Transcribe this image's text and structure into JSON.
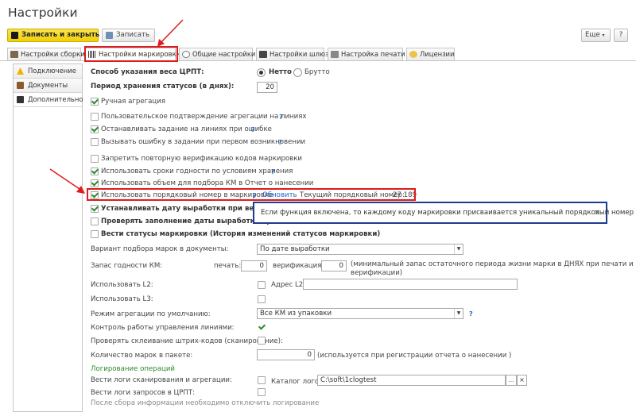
{
  "window": {
    "title": "Настройки"
  },
  "toolbar": {
    "save_close": "Записать и закрыть",
    "write": "Записать",
    "more": "Еще",
    "help": "?"
  },
  "tabs": [
    {
      "label": "Настройки сборки"
    },
    {
      "label": "Настройки маркировки"
    },
    {
      "label": "Общие настройки"
    },
    {
      "label": "Настройки шлюз"
    },
    {
      "label": "Настройка печати"
    },
    {
      "label": "Лицензии"
    }
  ],
  "left_tabs": [
    {
      "label": "Подключение"
    },
    {
      "label": "Документы"
    },
    {
      "label": "Дополнительно"
    }
  ],
  "weight": {
    "label": "Способ указания веса ЦРПТ:",
    "net": "Нетто",
    "gross": "Брутто"
  },
  "storage": {
    "label": "Период хранения статусов (в днях):",
    "value": "20"
  },
  "checks": {
    "manual": "Ручная агрегация",
    "confirm": "Пользовательское подтверждение агрегации на линиях",
    "stop": "Останавливать задание на линиях при ошибке",
    "firsterr": "Вызывать ошибку в задании при первом возникновении",
    "forbid": "Запретить повторную верификацию кодов маркировки",
    "expiry": "Использовать сроки годности по условиям хранения",
    "volume": "Использовать объем для подбора КМ в Отчет о нанесении",
    "seq": "Использовать порядковый номер в маркировке",
    "setdate": "Устанавливать дату выработки при верифик",
    "checkdate": "Проверять заполнение даты выработки при",
    "history": "Вести статусы маркировки (История изменений статусов маркировки)"
  },
  "seq_extra": {
    "help": "?",
    "refresh": "Обновить",
    "current_label": "Текущий порядковый номер:",
    "current_value": "27 189"
  },
  "tooltip": {
    "text": "Если функция включена, то каждому коду маркировки присваивается уникальный порядковый номер",
    "close": "×"
  },
  "form": {
    "variant_label": "Вариант подбора марок в документы:",
    "variant_value": "По дате выработки",
    "reserve_label": "Запас годности КМ:",
    "print_label": "печать:",
    "print_value": "0",
    "verif_label": "верификация:",
    "verif_value": "0",
    "reserve_note_1": "(минимальный запас остаточного периода жизни марки в ДНЯХ при печати и",
    "reserve_note_2": "верификации)",
    "l2_label": "Использовать L2:",
    "l2_addr_label": "Адрес L2:",
    "l3_label": "Использовать L3:",
    "mode_label": "Режим агрегации по умолчанию:",
    "mode_value": "Все КМ из упаковки",
    "lines_label": "Контроль работы управления линиями:",
    "glue_label": "Проверять склеивание штрих-кодов (сканирование):",
    "qty_label": "Количество марок в пакете:",
    "qty_value": "0",
    "qty_note": "(используется при регистрации  отчета о нанесении )",
    "log_section": "Логирование операций",
    "log_scan_label": "Вести логи сканирования и агрегации:",
    "log_dir_label": "Каталог логов:",
    "log_dir_value": "C:\\soft\\1clogtest",
    "log_crpt_label": "Вести логи запросов в ЦРПТ:",
    "footer_note": "После сбора информации необходимо отключить логирование"
  },
  "colors": {
    "accent": "#f1cf08",
    "link": "#1c68c8",
    "check": "#2e8b2e",
    "highlight": "#e01b1b",
    "tooltip_border": "#1d3b8f"
  }
}
